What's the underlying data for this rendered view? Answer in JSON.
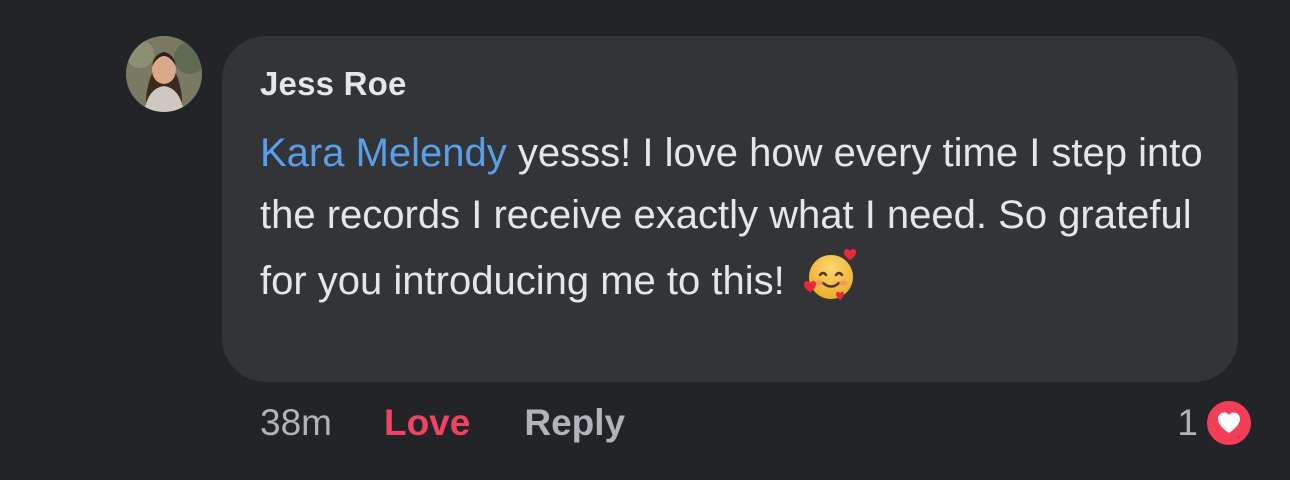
{
  "comment": {
    "author": "Jess Roe",
    "mention": "Kara Melendy",
    "text": " yesss! I love how every time I step into the records I receive exactly what I need. So grateful for you introducing me to this!",
    "emoji": "smiling-face-with-hearts"
  },
  "actions": {
    "timestamp": "38m",
    "love_label": "Love",
    "reply_label": "Reply"
  },
  "reactions": {
    "count": "1",
    "type": "heart-icon"
  },
  "colors": {
    "background": "#232427",
    "bubble": "#323437",
    "mention": "#5b9ee8",
    "love": "#f3425f",
    "muted": "#b0b3b8",
    "text": "#e4e6eb"
  }
}
